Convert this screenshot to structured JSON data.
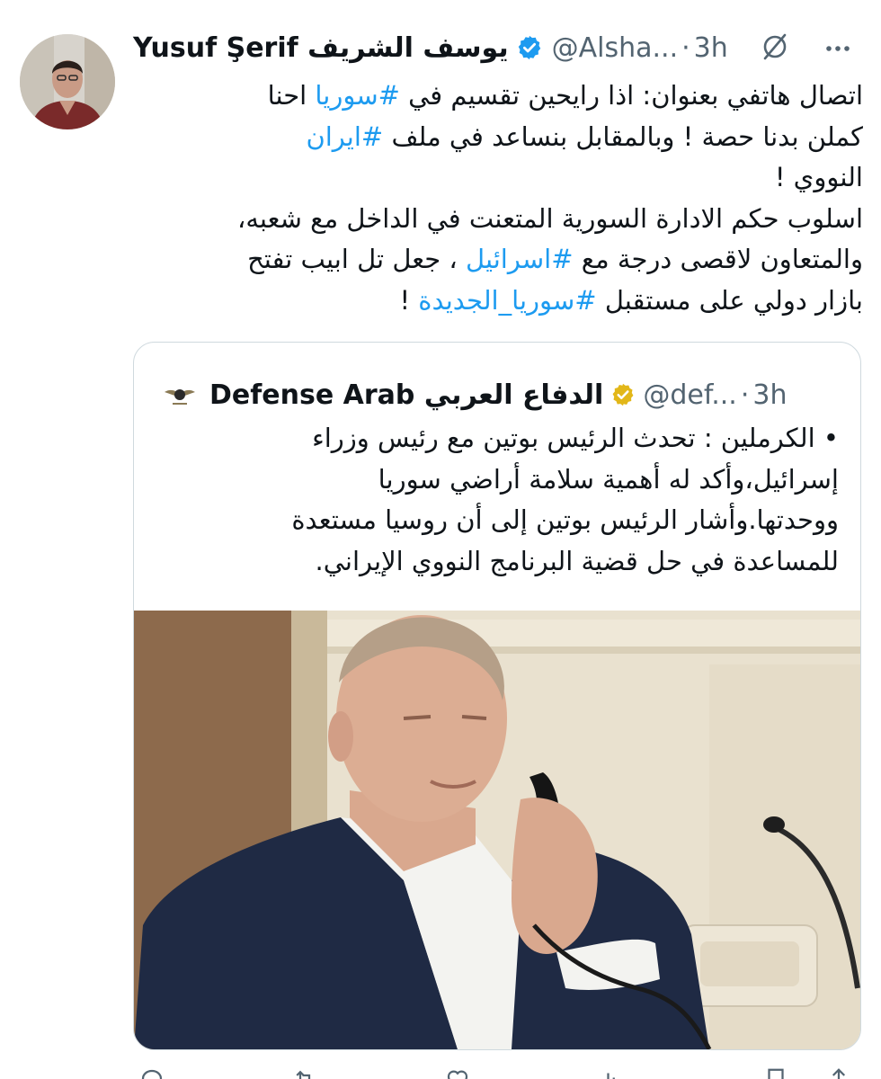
{
  "author": {
    "display_name": "Yusuf Şerif يوسف الشريف",
    "handle": "@Alsha...",
    "time": "3h"
  },
  "tweet": {
    "line1_a": "اتصال هاتفي بعنوان: اذا رايحين تقسيم في ",
    "line1_tag": "#سوريا",
    "line1_b": " احنا",
    "line2_a": "كملن بدنا حصة ! وبالمقابل بنساعد في ملف ",
    "line2_tag": "#ايران",
    "line3": "النووي !",
    "line4": "اسلوب حكم الادارة السورية المتعنت في الداخل مع شعبه،",
    "line5_a": "والمتعاون لاقصى درجة مع ",
    "line5_tag": "#اسرائيل",
    "line5_b": " ، جعل تل ابيب تفتح",
    "line6_a": "بازار دولي على مستقبل ",
    "line6_tag": "#سوريا_الجديدة",
    "line6_b": " !"
  },
  "quote": {
    "display_name": "Defense Arab الدفاع العربي",
    "handle": "@def...",
    "time": "3h",
    "lines": [
      "• الكرملين : تحدث الرئيس بوتين مع رئيس وزراء",
      "إسرائيل،وأكد له أهمية سلامة أراضي سوريا",
      "ووحدتها.وأشار الرئيس بوتين إلى أن روسيا مستعدة",
      "للمساعدة في حل قضية البرنامج النووي الإيراني."
    ]
  },
  "colors": {
    "text": "#0f1419",
    "secondary": "#536471",
    "link": "#1d9bf0",
    "verified_blue": "#1d9bf0",
    "verified_gold": "#e2b719",
    "border": "#cfd9de"
  },
  "icons": {
    "grok": "grok-icon",
    "more": "more-icon",
    "verified": "verified-badge-icon",
    "reply": "reply-icon",
    "retweet": "retweet-icon",
    "like": "heart-icon",
    "views": "views-icon",
    "bookmark": "bookmark-icon",
    "share": "share-icon"
  }
}
